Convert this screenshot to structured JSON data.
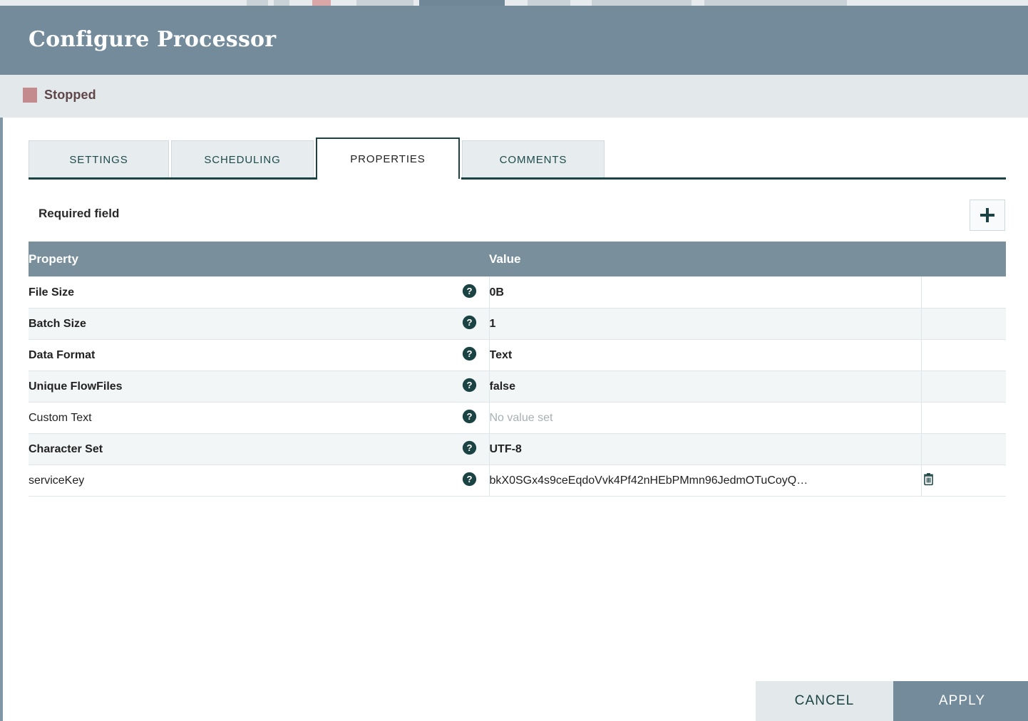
{
  "window": {
    "title": "Configure Processor"
  },
  "status": {
    "label": "Stopped",
    "color": "#c48b8f"
  },
  "tabs": [
    {
      "label": "SETTINGS",
      "active": false
    },
    {
      "label": "SCHEDULING",
      "active": false
    },
    {
      "label": "PROPERTIES",
      "active": true
    },
    {
      "label": "COMMENTS",
      "active": false
    }
  ],
  "toolbar": {
    "required_field_label": "Required field",
    "add_icon": "plus-icon"
  },
  "table": {
    "columns": [
      "Property",
      "Value"
    ],
    "rows": [
      {
        "property": "File Size",
        "required": true,
        "value": "0B",
        "value_set": true,
        "help_icon": "help-icon",
        "delete_icon": null
      },
      {
        "property": "Batch Size",
        "required": true,
        "value": "1",
        "value_set": true,
        "help_icon": "help-icon",
        "delete_icon": null
      },
      {
        "property": "Data Format",
        "required": true,
        "value": "Text",
        "value_set": true,
        "help_icon": "help-icon",
        "delete_icon": null
      },
      {
        "property": "Unique FlowFiles",
        "required": true,
        "value": "false",
        "value_set": true,
        "help_icon": "help-icon",
        "delete_icon": null
      },
      {
        "property": "Custom Text",
        "required": false,
        "value": "No value set",
        "value_set": false,
        "help_icon": "help-icon",
        "delete_icon": null
      },
      {
        "property": "Character Set",
        "required": true,
        "value": "UTF-8",
        "value_set": true,
        "help_icon": "help-icon",
        "delete_icon": null
      },
      {
        "property": "serviceKey",
        "required": false,
        "value": "bkX0SGx4s9ceEqdoVvk4Pf42nHEbPMmn96JedmOTuCoyQ…",
        "value_set": true,
        "help_icon": "help-icon",
        "delete_icon": "trash-icon"
      }
    ]
  },
  "footer": {
    "cancel_label": "CANCEL",
    "apply_label": "APPLY"
  },
  "colors": {
    "header_bg": "#748b9b",
    "status_bg": "#e3e8ea",
    "accent_teal": "#1b4343",
    "table_header_bg": "#7a8f9c",
    "row_even_bg": "#f3f6f7"
  }
}
